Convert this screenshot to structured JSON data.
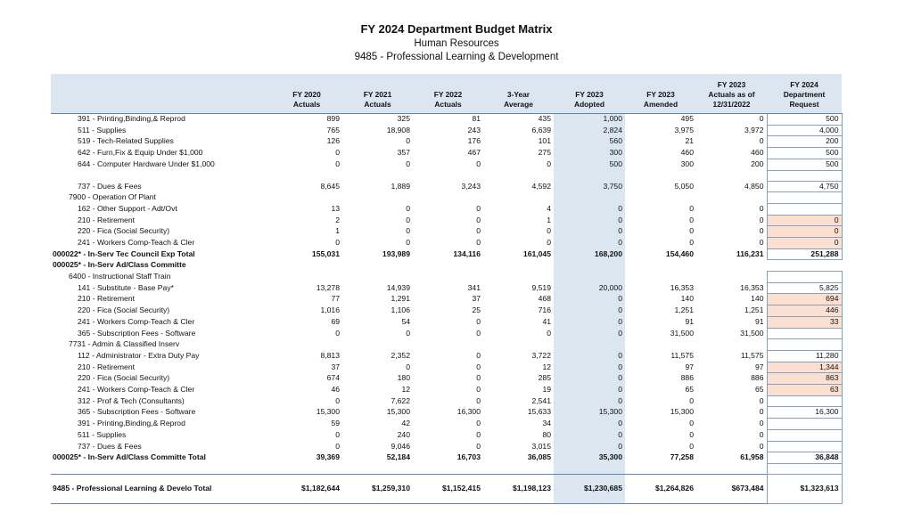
{
  "header": {
    "title": "FY 2024 Department Budget Matrix",
    "subtitle1": "Human Resources",
    "subtitle2": "9485 - Professional Learning & Development"
  },
  "columns": [
    [
      "FY 2020",
      "Actuals"
    ],
    [
      "FY 2021",
      "Actuals"
    ],
    [
      "FY 2022",
      "Actuals"
    ],
    [
      "3-Year",
      "Average"
    ],
    [
      "FY 2023",
      "Adopted"
    ],
    [
      "FY 2023",
      "Amended"
    ],
    [
      "FY 2023",
      "Actuals as of",
      "12/31/2022"
    ],
    [
      "FY 2024",
      "Department",
      "Request"
    ]
  ],
  "rows": [
    {
      "kind": "line",
      "indent": 2,
      "label": "391 - Printing,Binding,& Reprod",
      "values": [
        "899",
        "325",
        "81",
        "435",
        "1,000",
        "495",
        "0",
        "500"
      ]
    },
    {
      "kind": "line",
      "indent": 2,
      "label": "511 - Supplies",
      "values": [
        "765",
        "18,908",
        "243",
        "6,639",
        "2,824",
        "3,975",
        "3,972",
        "4,000"
      ]
    },
    {
      "kind": "line",
      "indent": 2,
      "label": "519 - Tech-Related Supplies",
      "values": [
        "126",
        "0",
        "176",
        "101",
        "560",
        "21",
        "0",
        "200"
      ]
    },
    {
      "kind": "line",
      "indent": 2,
      "label": "642 - Furn,Fix & Equip Under $1,000",
      "values": [
        "0",
        "357",
        "467",
        "275",
        "300",
        "460",
        "460",
        "500"
      ]
    },
    {
      "kind": "line",
      "indent": 2,
      "label": "644 - Computer Hardware Under $1,000",
      "values": [
        "0",
        "0",
        "0",
        "0",
        "500",
        "300",
        "200",
        "500"
      ]
    },
    {
      "kind": "spacer"
    },
    {
      "kind": "line",
      "indent": 2,
      "label": "737 - Dues & Fees",
      "values": [
        "8,645",
        "1,889",
        "3,243",
        "4,592",
        "3,750",
        "5,050",
        "4,850",
        "4,750"
      ]
    },
    {
      "kind": "line",
      "indent": 1,
      "label": "7900 - Operation Of Plant",
      "values": [
        "",
        "",
        "",
        "",
        "",
        "",
        "",
        ""
      ]
    },
    {
      "kind": "line",
      "indent": 2,
      "label": "162 - Other Support - Adt/Ovt",
      "values": [
        "13",
        "0",
        "0",
        "4",
        "0",
        "0",
        "0",
        ""
      ]
    },
    {
      "kind": "line",
      "indent": 2,
      "label": "210 - Retirement",
      "values": [
        "2",
        "0",
        "0",
        "1",
        "0",
        "0",
        "0",
        "0"
      ],
      "peach": true
    },
    {
      "kind": "line",
      "indent": 2,
      "label": "220 - Fica (Social Security)",
      "values": [
        "1",
        "0",
        "0",
        "0",
        "0",
        "0",
        "0",
        "0"
      ],
      "peach": true
    },
    {
      "kind": "line",
      "indent": 2,
      "label": "241 - Workers Comp-Teach & Cler",
      "values": [
        "0",
        "0",
        "0",
        "0",
        "0",
        "0",
        "0",
        "0"
      ],
      "peach": true
    },
    {
      "kind": "bold",
      "indent": 0,
      "label": "000022* - In-Serv Tec Council Exp Total",
      "values": [
        "155,031",
        "193,989",
        "134,116",
        "161,045",
        "168,200",
        "154,460",
        "116,231",
        "251,288"
      ]
    },
    {
      "kind": "bold",
      "indent": 0,
      "label": "000025* - In-Serv Ad/Class Committe",
      "values": [
        "",
        "",
        "",
        "",
        "",
        "",
        "",
        ""
      ],
      "noBox": true
    },
    {
      "kind": "line",
      "indent": 1,
      "label": "6400 - Instructional Staff Train",
      "values": [
        "",
        "",
        "",
        "",
        "",
        "",
        "",
        ""
      ]
    },
    {
      "kind": "line",
      "indent": 2,
      "label": "141 - Substitute - Base Pay*",
      "values": [
        "13,278",
        "14,939",
        "341",
        "9,519",
        "20,000",
        "16,353",
        "16,353",
        "5,825"
      ]
    },
    {
      "kind": "line",
      "indent": 2,
      "label": "210 - Retirement",
      "values": [
        "77",
        "1,291",
        "37",
        "468",
        "0",
        "140",
        "140",
        "694"
      ],
      "peach": true
    },
    {
      "kind": "line",
      "indent": 2,
      "label": "220 - Fica (Social Security)",
      "values": [
        "1,016",
        "1,106",
        "25",
        "716",
        "0",
        "1,251",
        "1,251",
        "446"
      ],
      "peach": true
    },
    {
      "kind": "line",
      "indent": 2,
      "label": "241 - Workers Comp-Teach & Cler",
      "values": [
        "69",
        "54",
        "0",
        "41",
        "0",
        "91",
        "91",
        "33"
      ],
      "peach": true
    },
    {
      "kind": "line",
      "indent": 2,
      "label": "365 - Subscription Fees - Software",
      "values": [
        "0",
        "0",
        "0",
        "0",
        "0",
        "31,500",
        "31,500",
        ""
      ]
    },
    {
      "kind": "line",
      "indent": 1,
      "label": "7731 - Admin & Classified Inserv",
      "values": [
        "",
        "",
        "",
        "",
        "",
        "",
        "",
        ""
      ]
    },
    {
      "kind": "line",
      "indent": 2,
      "label": "112 - Administrator - Extra Duty Pay",
      "values": [
        "8,813",
        "2,352",
        "0",
        "3,722",
        "0",
        "11,575",
        "11,575",
        "11,280"
      ]
    },
    {
      "kind": "line",
      "indent": 2,
      "label": "210 - Retirement",
      "values": [
        "37",
        "0",
        "0",
        "12",
        "0",
        "97",
        "97",
        "1,344"
      ],
      "peach": true
    },
    {
      "kind": "line",
      "indent": 2,
      "label": "220 - Fica (Social Security)",
      "values": [
        "674",
        "180",
        "0",
        "285",
        "0",
        "886",
        "886",
        "863"
      ],
      "peach": true
    },
    {
      "kind": "line",
      "indent": 2,
      "label": "241 - Workers Comp-Teach & Cler",
      "values": [
        "46",
        "12",
        "0",
        "19",
        "0",
        "65",
        "65",
        "63"
      ],
      "peach": true
    },
    {
      "kind": "line",
      "indent": 2,
      "label": "312 - Prof & Tech (Consultants)",
      "values": [
        "0",
        "7,622",
        "0",
        "2,541",
        "0",
        "0",
        "0",
        ""
      ]
    },
    {
      "kind": "line",
      "indent": 2,
      "label": "365 - Subscription Fees - Software",
      "values": [
        "15,300",
        "15,300",
        "16,300",
        "15,633",
        "15,300",
        "15,300",
        "0",
        "16,300"
      ]
    },
    {
      "kind": "line",
      "indent": 2,
      "label": "391 - Printing,Binding,& Reprod",
      "values": [
        "59",
        "42",
        "0",
        "34",
        "0",
        "0",
        "0",
        ""
      ]
    },
    {
      "kind": "line",
      "indent": 2,
      "label": "511 - Supplies",
      "values": [
        "0",
        "240",
        "0",
        "80",
        "0",
        "0",
        "0",
        ""
      ]
    },
    {
      "kind": "line",
      "indent": 2,
      "label": "737 - Dues & Fees",
      "values": [
        "0",
        "9,046",
        "0",
        "3,015",
        "0",
        "0",
        "0",
        ""
      ]
    },
    {
      "kind": "bold",
      "indent": 0,
      "label": "000025* - In-Serv Ad/Class Committe Total",
      "values": [
        "39,369",
        "52,184",
        "16,703",
        "36,085",
        "35,300",
        "77,258",
        "61,958",
        "36,848"
      ]
    },
    {
      "kind": "spacer"
    },
    {
      "kind": "total",
      "indent": 0,
      "label": "9485 - Professional Learning & Develo Total",
      "values": [
        "$1,182,644",
        "$1,259,310",
        "$1,152,415",
        "$1,198,123",
        "$1,230,685",
        "$1,264,826",
        "$673,484",
        "$1,323,613"
      ]
    }
  ],
  "colors": {
    "header_bg": "#dce6f1",
    "adopted_bg": "#dce6f1",
    "peach": "#fbe0d2",
    "rule": "#5b83b5"
  }
}
